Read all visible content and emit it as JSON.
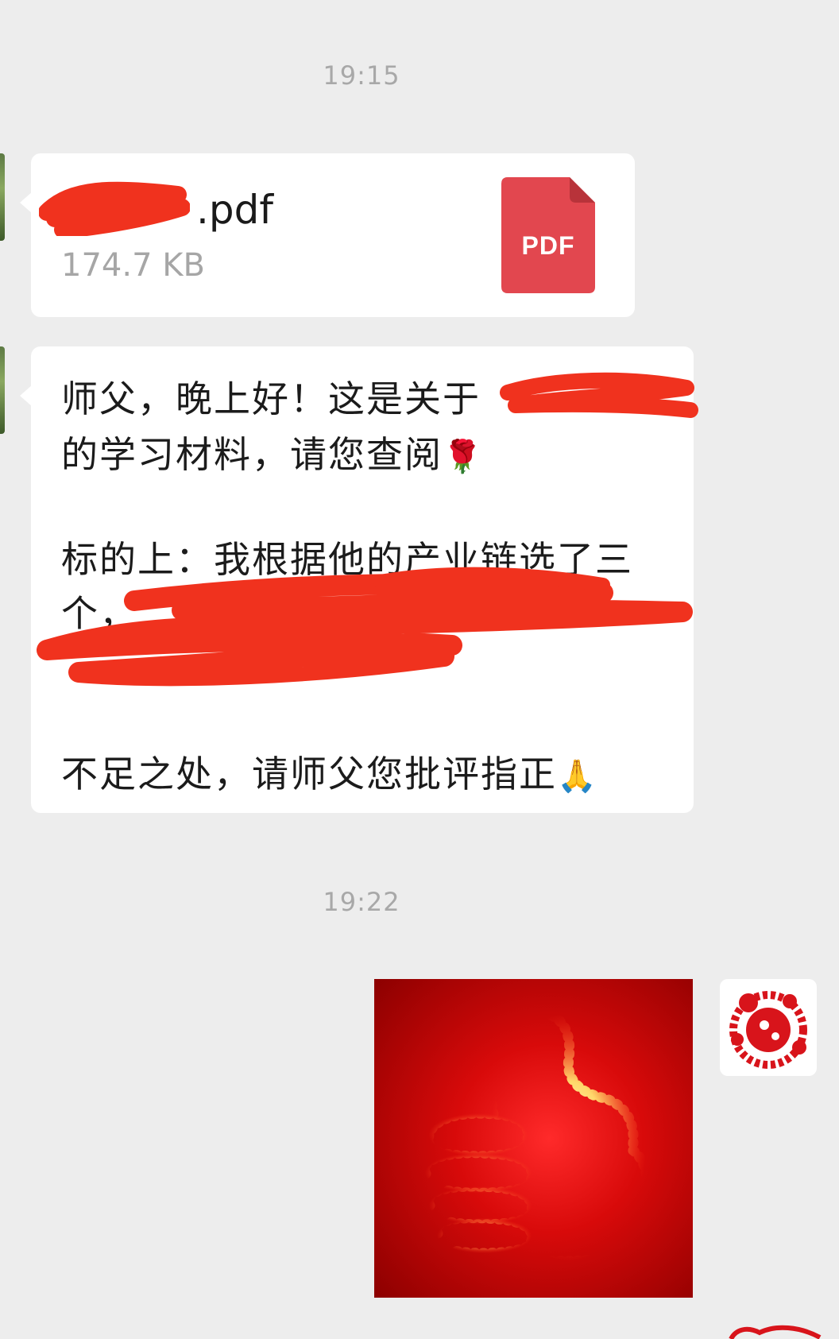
{
  "chat": {
    "timestamp_1": "19:15",
    "timestamp_2": "19:22",
    "file_message": {
      "file_name": ".pdf",
      "file_size": "174.7 KB",
      "icon_label": "PDF",
      "icon_color": "#e2474f"
    },
    "text_message": {
      "line_1": "师父，晚上好！这是关于",
      "line_2": "的学习材料，请您查阅",
      "line_2_emoji": "🌹",
      "line_3": "标的上：我根据他的产业链选了三",
      "line_4": "个，",
      "line_5": "不足之处，请师父您批评指正",
      "line_5_emoji": "🙏"
    },
    "sent_image": {
      "icon": "thumbs-up-icon",
      "background_color": "#d80a0a"
    },
    "self_avatar": {
      "icon": "paper-cut-avatar-icon",
      "color": "#d8141b"
    },
    "redaction_color": "#f0321e"
  }
}
